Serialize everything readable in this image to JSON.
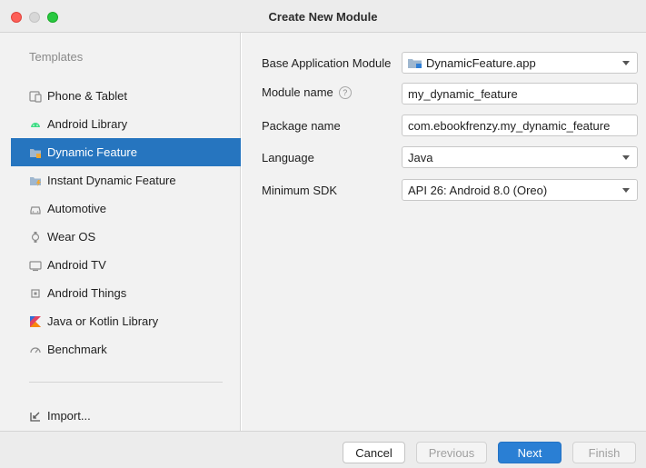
{
  "window": {
    "title": "Create New Module"
  },
  "sidebar": {
    "heading": "Templates",
    "items": [
      {
        "label": "Phone & Tablet",
        "icon": "phone-tablet-icon"
      },
      {
        "label": "Android Library",
        "icon": "android-icon"
      },
      {
        "label": "Dynamic Feature",
        "icon": "dynamic-feature-icon",
        "selected": true
      },
      {
        "label": "Instant Dynamic Feature",
        "icon": "instant-dynamic-feature-icon"
      },
      {
        "label": "Automotive",
        "icon": "car-icon"
      },
      {
        "label": "Wear OS",
        "icon": "watch-icon"
      },
      {
        "label": "Android TV",
        "icon": "tv-icon"
      },
      {
        "label": "Android Things",
        "icon": "chip-icon"
      },
      {
        "label": "Java or Kotlin Library",
        "icon": "kotlin-icon"
      },
      {
        "label": "Benchmark",
        "icon": "gauge-icon"
      }
    ],
    "import_label": "Import..."
  },
  "form": {
    "base_module": {
      "label": "Base Application Module",
      "value": "DynamicFeature.app"
    },
    "module_name": {
      "label": "Module name",
      "value": "my_dynamic_feature"
    },
    "package_name": {
      "label": "Package name",
      "value": "com.ebookfrenzy.my_dynamic_feature"
    },
    "language": {
      "label": "Language",
      "value": "Java"
    },
    "min_sdk": {
      "label": "Minimum SDK",
      "value": "API 26: Android 8.0 (Oreo)"
    }
  },
  "footer": {
    "cancel": "Cancel",
    "previous": "Previous",
    "next": "Next",
    "finish": "Finish"
  },
  "colors": {
    "selection": "#2675bf",
    "primary_button": "#2a7fd4"
  }
}
